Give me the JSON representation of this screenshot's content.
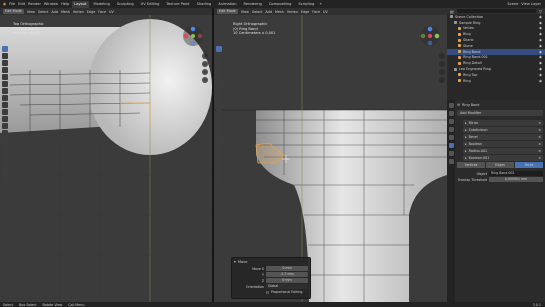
{
  "topbar": {
    "menus": [
      "File",
      "Edit",
      "Render",
      "Window",
      "Help"
    ],
    "workspaces": [
      "Layout",
      "Modeling",
      "Sculpting",
      "UV Editing",
      "Texture Paint",
      "Shading",
      "Animation",
      "Rendering",
      "Compositing",
      "Scripting"
    ],
    "active_workspace": "Layout",
    "scene": "Scene",
    "view_layer": "View Layer"
  },
  "left_viewport": {
    "mode": "Edit Mode",
    "menus": [
      "View",
      "Select",
      "Add",
      "Mesh",
      "Vertex",
      "Edge",
      "Face",
      "UV"
    ],
    "overlay_lines": [
      "Top Orthographic",
      "(0) Ring Band",
      "Meters x 6.001"
    ]
  },
  "right_viewport": {
    "mode": "Edit Mode",
    "menus": [
      "View",
      "Select",
      "Add",
      "Mesh",
      "Vertex",
      "Edge",
      "Face",
      "UV"
    ],
    "overlay_lines": [
      "Right Orthographic",
      "(0) Ring Band",
      "10 Centimeters x 0.001"
    ]
  },
  "outliner": {
    "title": "Scene Collection",
    "items": [
      {
        "label": "Scene Collection",
        "color": "#9a9a9a",
        "selected": false
      },
      {
        "label": "Sample Ring",
        "color": "#9a9a9a",
        "selected": false
      },
      {
        "label": "Vertex",
        "color": "#e8a34d",
        "selected": false
      },
      {
        "label": "Ring",
        "color": "#e8a34d",
        "selected": false
      },
      {
        "label": "Shank",
        "color": "#e8a34d",
        "selected": false
      },
      {
        "label": "Stone",
        "color": "#e8a34d",
        "selected": false
      },
      {
        "label": "Ring Band",
        "color": "#e8a34d",
        "selected": true
      },
      {
        "label": "Ring Band.001",
        "color": "#e8a34d",
        "selected": false
      },
      {
        "label": "Ring Detail",
        "color": "#e8a34d",
        "selected": false
      },
      {
        "label": "Leo Engraved Ring",
        "color": "#9a9a9a",
        "selected": false
      },
      {
        "label": "Ring Top",
        "color": "#e8a34d",
        "selected": false
      },
      {
        "label": "Ring",
        "color": "#e8a34d",
        "selected": false
      }
    ]
  },
  "properties": {
    "object_name": "Ring Band",
    "add_modifier": "Add Modifier",
    "modifiers": [
      "Mirror",
      "Subdivision",
      "Bevel",
      "Boolean",
      "Radius.001",
      "Boolean.001"
    ],
    "tabs": [
      "Vertices",
      "Edges",
      "Faces"
    ],
    "active_tab": "Faces",
    "object_label": "Object",
    "object_value": "Ring Band.002",
    "overlap_label": "Overlap Threshold",
    "overlap_value": "0.000001 mm"
  },
  "popup": {
    "title": "Move",
    "rows": [
      {
        "label": "Move X",
        "value": "0 mm"
      },
      {
        "label": "Y",
        "value": "-1.7 mm"
      },
      {
        "label": "Z",
        "value": "0 mm"
      }
    ],
    "orientation_label": "Orientation",
    "orientation_value": "Global",
    "checkbox_label": "Proportional Editing"
  },
  "statusbar": {
    "items": [
      "Select",
      "Box Select",
      "Rotate View",
      "Call Menu"
    ],
    "version": "3.0.1"
  },
  "colors": {
    "accent": "#4772b3",
    "selection_orange": "#e8a34d",
    "viewport_bg": "#3b3b3b"
  }
}
